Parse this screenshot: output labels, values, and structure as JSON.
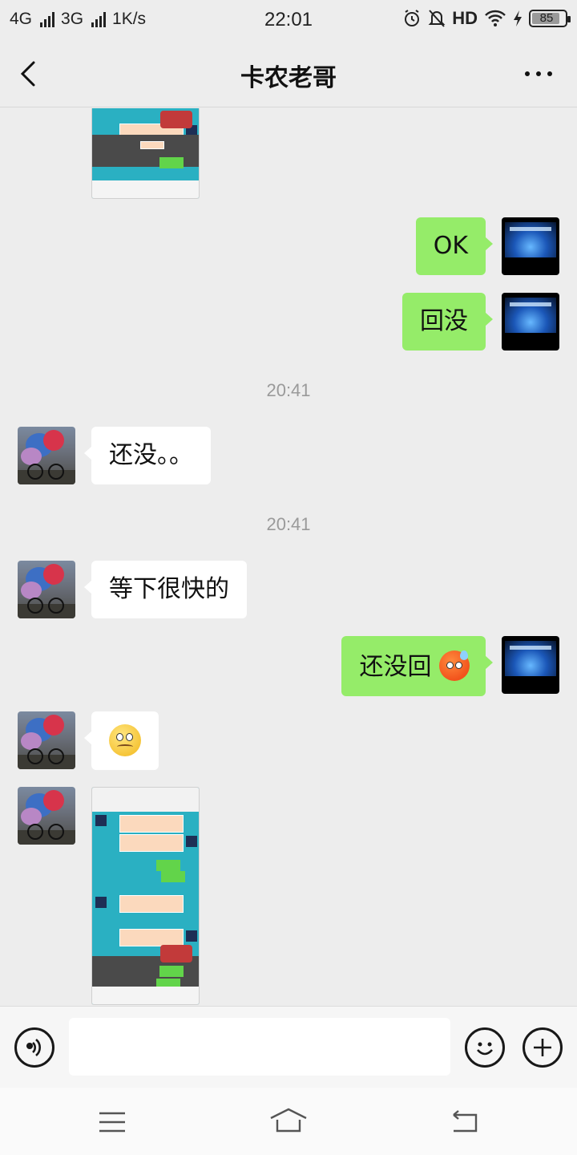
{
  "status_bar": {
    "network1": "4G",
    "network2": "3G",
    "speed": "1K/s",
    "time": "22:01",
    "hd": "HD",
    "battery": "85"
  },
  "header": {
    "title": "卡农老哥"
  },
  "messages": {
    "m1": "OK",
    "m2": "回没",
    "t1": "20:41",
    "m3": "还没。。",
    "t2": "20:41",
    "m4": "等下很快的",
    "m5": "还没回"
  },
  "colors": {
    "bubble_out": "#95ec69",
    "bubble_in": "#ffffff",
    "background": "#ededed"
  }
}
